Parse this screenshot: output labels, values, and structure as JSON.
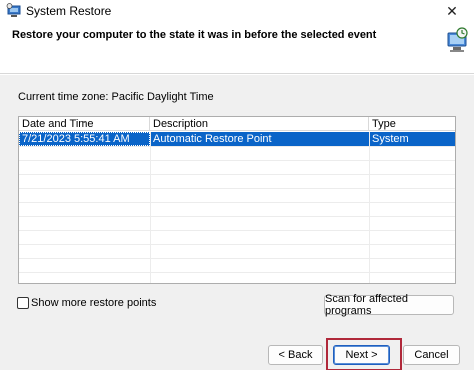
{
  "window": {
    "title": "System Restore",
    "close_glyph": "✕",
    "app_icon": "system-restore-icon"
  },
  "header": {
    "heading": "Restore your computer to the state it was in before the selected event",
    "icon": "restore-computer-icon"
  },
  "timezone_label": "Current time zone: Pacific Daylight Time",
  "table": {
    "columns": [
      "Date and Time",
      "Description",
      "Type"
    ],
    "sort_indicator": "⌄",
    "rows": [
      {
        "date": "7/21/2023 5:55:41 AM",
        "description": "Automatic Restore Point",
        "type": "System",
        "selected": true
      }
    ]
  },
  "show_more_label": "Show more restore points",
  "show_more_checked": false,
  "buttons": {
    "scan": "Scan for affected programs",
    "back": "< Back",
    "next": "Next >",
    "cancel": "Cancel"
  },
  "colors": {
    "selection": "#0a64c8",
    "highlight_frame": "#b0283a"
  }
}
